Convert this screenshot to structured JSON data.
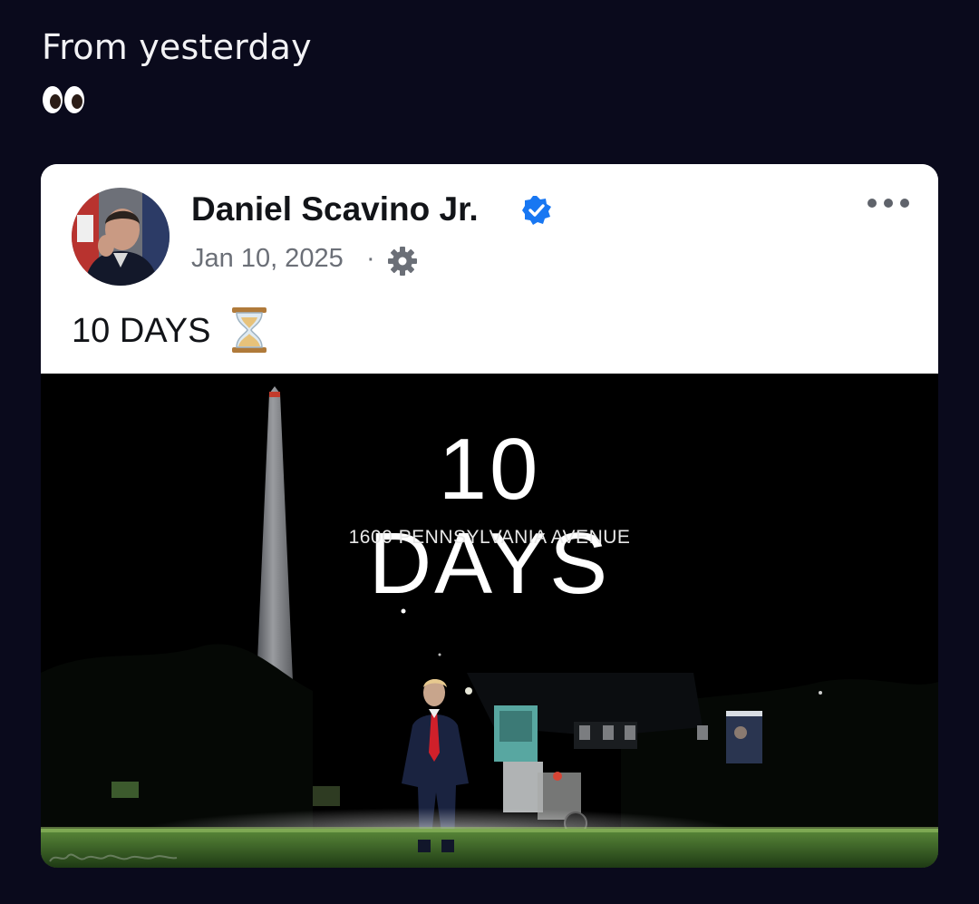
{
  "caption": {
    "text": "From yesterday",
    "emoji_icon": "eyes-emoji-icon"
  },
  "post": {
    "author": "Daniel Scavino Jr.",
    "verified_icon": "verified-badge-icon",
    "date": "Jan 10, 2025",
    "separator": "·",
    "audience_icon": "gear-icon",
    "more_icon": "more-options-icon",
    "text": "10 DAYS",
    "text_emoji_icon": "hourglass-icon",
    "image": {
      "headline": "10 DAYS",
      "subheadline": "1600 PENNSYLVANIA AVENUE",
      "watermark_icon": "dan-scavino-signature-watermark"
    }
  },
  "colors": {
    "page_background": "#0a0a1c",
    "card_background": "#ffffff",
    "verified_blue": "#1877f2",
    "secondary_text": "#6b6f77",
    "image_background": "#000000",
    "lawn_green": "#3f6a2a"
  }
}
